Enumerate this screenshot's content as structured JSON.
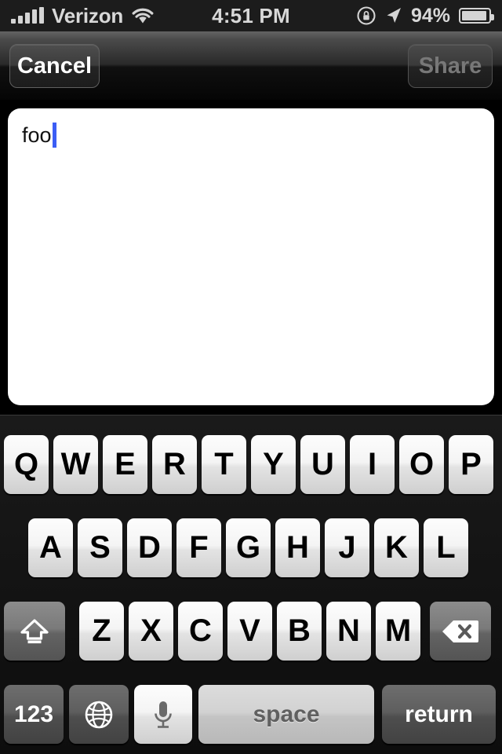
{
  "status_bar": {
    "carrier": "Verizon",
    "signal_icon": "signal-bars-icon",
    "wifi_icon": "wifi-icon",
    "time": "4:51 PM",
    "rotation_lock_icon": "rotation-lock-icon",
    "location_icon": "location-arrow-icon",
    "battery_percent": "94%",
    "battery_icon": "battery-icon",
    "battery_level": 94
  },
  "nav_bar": {
    "cancel_label": "Cancel",
    "share_label": "Share",
    "share_enabled": false
  },
  "compose": {
    "text_value": "foo",
    "placeholder": "",
    "caret_color": "#3b5df5"
  },
  "keyboard": {
    "layout": "qwerty-uppercase",
    "row1": [
      "Q",
      "W",
      "E",
      "R",
      "T",
      "Y",
      "U",
      "I",
      "O",
      "P"
    ],
    "row2": [
      "A",
      "S",
      "D",
      "F",
      "G",
      "H",
      "J",
      "K",
      "L"
    ],
    "row3": [
      "Z",
      "X",
      "C",
      "V",
      "B",
      "N",
      "M"
    ],
    "shift_icon": "shift-arrow-icon",
    "backspace_icon": "backspace-delete-icon",
    "numbers_label": "123",
    "globe_icon": "globe-icon",
    "dictation_icon": "microphone-icon",
    "space_label": "space",
    "return_label": "return"
  },
  "colors": {
    "caret_blue": "#3b5df5",
    "key_light": "#f4f4f4",
    "key_dark": "#6e6e6e",
    "status_text": "#d8d8d8",
    "disabled_text": "#787878"
  }
}
